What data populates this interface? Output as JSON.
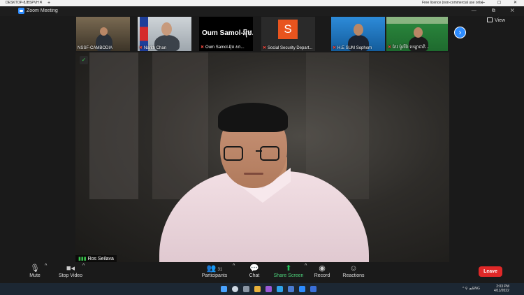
{
  "remote_bar": {
    "tab_title": "DESKTOP-8JBSPVH",
    "close_glyph": "✕",
    "new_tab_glyph": "+",
    "license_text": "Free licence (non-commercial use only)",
    "toolbox_glyphs": "▭ ⊞ ✕",
    "window_controls": "— ▢ ✕"
  },
  "window": {
    "title": "Zoom Meeting",
    "controls": "— ⧉ ✕"
  },
  "view_button": {
    "label": "View",
    "icon": "grid-icon"
  },
  "gallery": [
    {
      "name": "NSSF-CAMBODIA",
      "muted": false
    },
    {
      "name": "Narith Chan",
      "muted": true
    },
    {
      "name": "Oum Samol-អ៊ុម សា...",
      "muted": true,
      "display_name": "Oum Samol-អ៊ុម..."
    },
    {
      "name": "Social Security Depart...",
      "muted": true,
      "avatar_letter": "S"
    },
    {
      "name": "H.E SUM Sophorn",
      "muted": true
    },
    {
      "name": "កែវ ម៉ូលីរ៉ា បេឡាជាតិ...",
      "muted": true
    }
  ],
  "next_page_glyph": "›",
  "main_video": {
    "name": "Ros Seilava",
    "shield_glyph": "✓",
    "signal_glyph": "▮▮▮"
  },
  "toolbar": {
    "mute_label": "Mute",
    "stop_video_label": "Stop Video",
    "participants_label": "Participants",
    "participants_count": "31",
    "chat_label": "Chat",
    "share_screen_label": "Share Screen",
    "record_label": "Record",
    "reactions_label": "Reactions",
    "leave_label": "Leave",
    "caret": "^"
  },
  "taskbar": {
    "lang": "ENG",
    "time": "2:03 PM",
    "date": "4/11/2022",
    "tray_glyphs": "^ ⚲ ☁ ♪"
  },
  "colors": {
    "accent": "#2d8cff",
    "leave": "#e02828",
    "share": "#23c15a",
    "muted_mic": "#e0433a"
  }
}
